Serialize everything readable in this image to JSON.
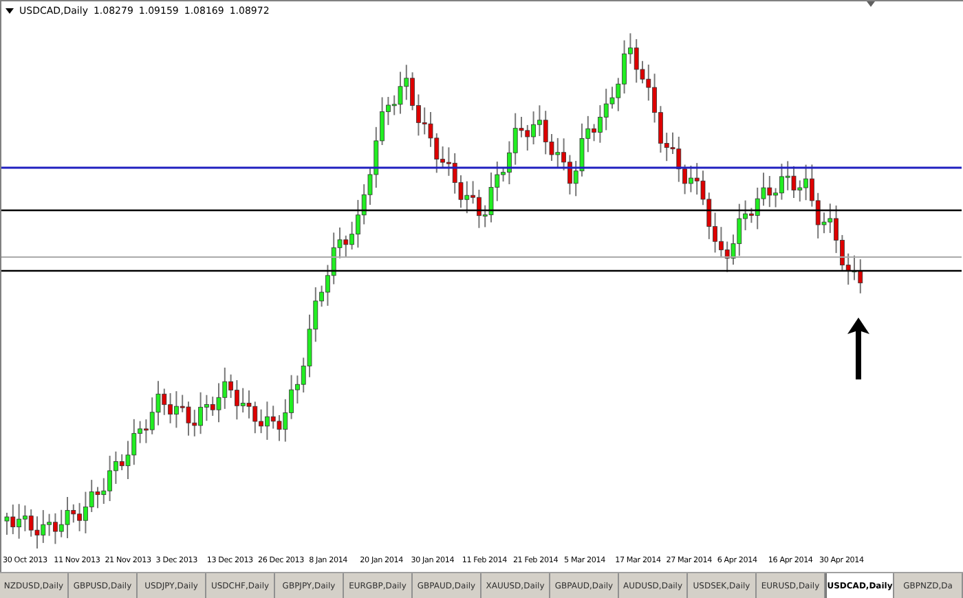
{
  "chart": {
    "symbol": "USDCAD,Daily",
    "prices": [
      "1.08279",
      "1.09159",
      "1.08169",
      "1.08972"
    ],
    "dates": [
      "30 Oct 2013",
      "11 Nov 2013",
      "21 Nov 2013",
      "3 Dec 2013",
      "13 Dec 2013",
      "26 Dec 2013",
      "8 Jan 2014",
      "20 Jan 2014",
      "30 Jan 2014",
      "11 Feb 2014",
      "21 Feb 2014",
      "5 Mar 2014",
      "17 Mar 2014",
      "27 Mar 2014",
      "6 Apr 2014",
      "16 Apr 2014",
      "30 Apr 2014"
    ]
  },
  "tabs": [
    {
      "label": "NZDUSD,Daily",
      "selected": false
    },
    {
      "label": "GBPUSD,Daily",
      "selected": false
    },
    {
      "label": "USDJPY,Daily",
      "selected": false
    },
    {
      "label": "USDCHF,Daily",
      "selected": false
    },
    {
      "label": "GBPJPY,Daily",
      "selected": false
    },
    {
      "label": "EURGBP,Daily",
      "selected": false
    },
    {
      "label": "GBPAUD,Daily",
      "selected": false
    },
    {
      "label": "XAUUSD,Daily",
      "selected": false
    },
    {
      "label": "GBPAUD,Daily",
      "selected": false
    },
    {
      "label": "AUDUSD,Daily",
      "selected": false
    },
    {
      "label": "USDSEK,Daily",
      "selected": false
    },
    {
      "label": "EURUSD,Daily",
      "selected": false
    },
    {
      "label": "USDCAD,Daily",
      "selected": true
    },
    {
      "label": "GBPNZD,Da",
      "selected": false
    }
  ]
}
